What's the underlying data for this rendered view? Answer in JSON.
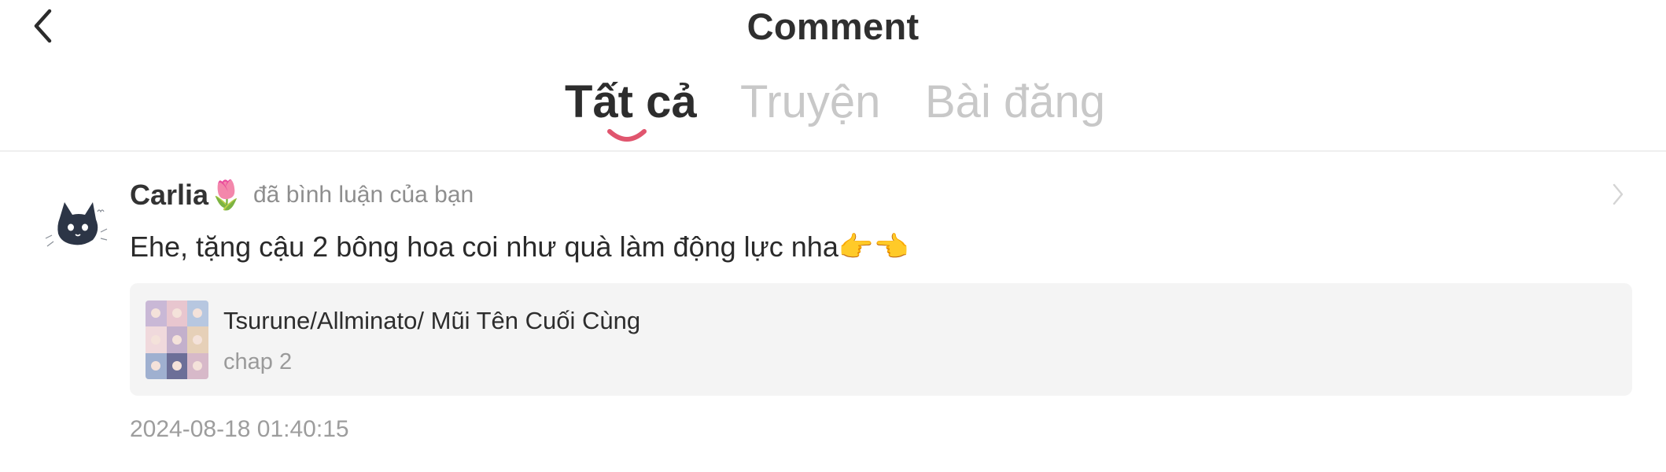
{
  "header": {
    "title": "Comment",
    "back_icon": "chevron-left-icon"
  },
  "tabs": [
    {
      "label": "Tất cả",
      "active": true
    },
    {
      "label": "Truyện",
      "active": false
    },
    {
      "label": "Bài đăng",
      "active": false
    }
  ],
  "colors": {
    "accent": "#e0556e",
    "inactive_tab": "#c8c8c8",
    "card_bg": "#f4f4f4"
  },
  "notification": {
    "user_name": "Carlia",
    "user_emoji": "🌷",
    "action_text": "đã bình luận của bạn",
    "comment_text": "Ehe, tặng cậu 2 bông hoa coi như quà làm động lực nha",
    "comment_emoji": "👉👈",
    "card": {
      "title": "Tsurune/Allminato/ Mũi Tên Cuối Cùng",
      "subtitle": "chap 2"
    },
    "timestamp": "2024-08-18 01:40:15",
    "chevron_icon": "chevron-right-icon"
  }
}
